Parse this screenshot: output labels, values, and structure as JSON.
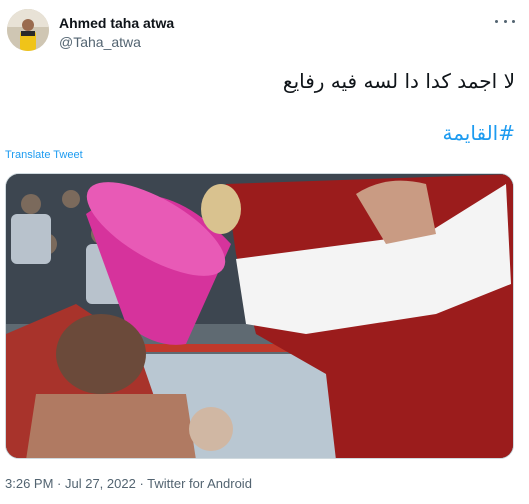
{
  "author": {
    "name": "Ahmed taha atwa",
    "handle": "@Taha_atwa"
  },
  "tweet": {
    "text": "لا اجمد كدا دا لسه فيه رفايع",
    "hashtag": "#القايمة",
    "translate_label": "Translate Tweet"
  },
  "meta": {
    "time": "3:26 PM",
    "separator": " · ",
    "date": "Jul 27, 2022",
    "source": "Twitter for Android"
  },
  "icons": {
    "more": "more-horizontal-icon"
  },
  "colors": {
    "link": "#1d9bf0",
    "secondary_text": "#536471",
    "primary_text": "#0f1419"
  }
}
